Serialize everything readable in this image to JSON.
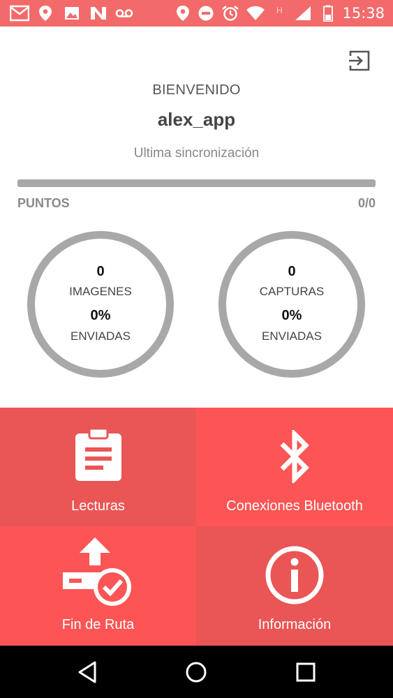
{
  "status_bar": {
    "time": "15:38",
    "left_icons": [
      "gmail-icon",
      "location-icon",
      "image-icon",
      "n-notification-icon",
      "voicemail-icon"
    ],
    "right_icons": [
      "location-icon",
      "do-not-disturb-icon",
      "alarm-icon",
      "wifi-icon",
      "h-network-icon",
      "signal-icon",
      "battery-icon"
    ]
  },
  "header": {
    "logout_icon": "logout-icon",
    "welcome": "BIENVENIDO",
    "username": "alex_app",
    "sync_label": "Ultima sincronización"
  },
  "points": {
    "label": "PUNTOS",
    "value": "0/0",
    "progress_fraction": 0
  },
  "stats": [
    {
      "count": "0",
      "label": "IMAGENES",
      "percent": "0%",
      "status": "ENVIADAS"
    },
    {
      "count": "0",
      "label": "CAPTURAS",
      "percent": "0%",
      "status": "ENVIADAS"
    }
  ],
  "tiles": [
    {
      "label": "Lecturas",
      "icon": "clipboard-icon"
    },
    {
      "label": "Conexiones Bluetooth",
      "icon": "bluetooth-icon"
    },
    {
      "label": "Fin de Ruta",
      "icon": "route-end-icon"
    },
    {
      "label": "Información",
      "icon": "info-icon"
    }
  ],
  "colors": {
    "accent": "#f26a6a",
    "tile_dark": "#ea5555",
    "tile_light": "#fd5555",
    "ring": "#a8a8a8"
  },
  "navbar": {
    "icons": [
      "back-icon",
      "home-icon",
      "recents-icon"
    ]
  }
}
